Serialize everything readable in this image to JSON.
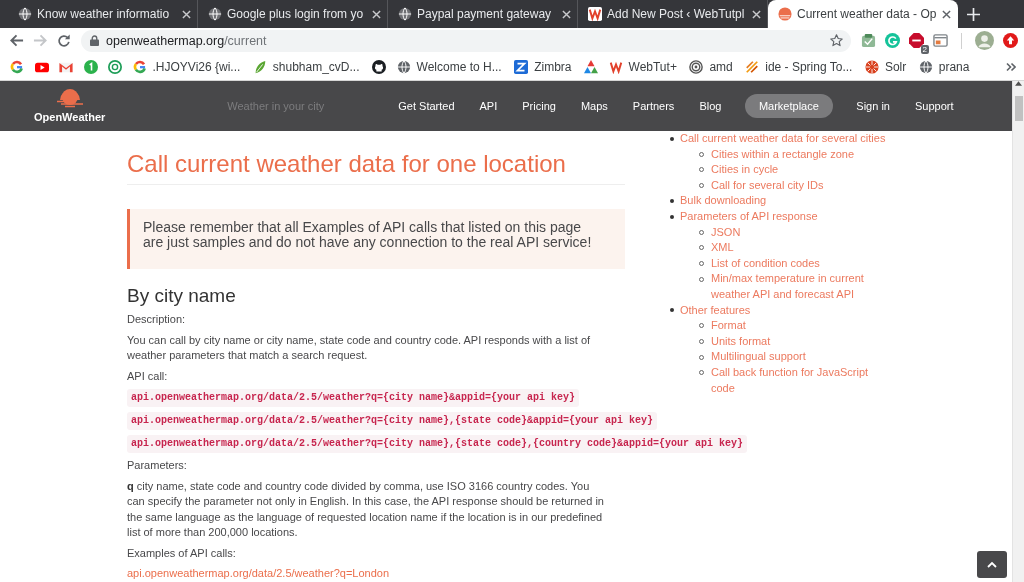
{
  "browser": {
    "tabs": [
      {
        "title": "Know weather informatio",
        "selected": false
      },
      {
        "title": "Google plus login from yo",
        "selected": false
      },
      {
        "title": "Paypal payment gateway",
        "selected": false
      },
      {
        "title": "Add New Post ‹ WebTutpl",
        "selected": false
      },
      {
        "title": "Current weather data - Op",
        "selected": true
      }
    ],
    "toolbar": {
      "forward_disabled": true,
      "url_host": "openweathermap.org",
      "url_path": "/current",
      "extension_badge": "2"
    },
    "bookmarks": [
      {
        "kind": "icon"
      },
      {
        "kind": "icon"
      },
      {
        "kind": "icon"
      },
      {
        "kind": "icon"
      },
      {
        "kind": "icon"
      },
      {
        "kind": "link",
        "label": ".HJOYVi26 {wi..."
      },
      {
        "kind": "link",
        "label": "shubham_cvD..."
      },
      {
        "kind": "icon"
      },
      {
        "kind": "link",
        "label": "Welcome to H..."
      },
      {
        "kind": "link",
        "label": "Zimbra"
      },
      {
        "kind": "icon"
      },
      {
        "kind": "link",
        "label": "WebTut+"
      },
      {
        "kind": "link",
        "label": "amd"
      },
      {
        "kind": "link",
        "label": "ide - Spring To..."
      },
      {
        "kind": "link",
        "label": "Solr"
      },
      {
        "kind": "link",
        "label": "prana"
      }
    ]
  },
  "site_header": {
    "logo_text": "OpenWeather",
    "search": {
      "placeholder": "Weather in your city"
    },
    "nav": [
      {
        "label": "Get Started",
        "kind": "link"
      },
      {
        "label": "API",
        "kind": "link"
      },
      {
        "label": "Pricing",
        "kind": "link"
      },
      {
        "label": "Maps",
        "kind": "link"
      },
      {
        "label": "Partners",
        "kind": "link"
      },
      {
        "label": "Blog",
        "kind": "link"
      },
      {
        "label": "Marketplace",
        "kind": "pill"
      },
      {
        "label": "Sign in",
        "kind": "link"
      },
      {
        "label": "Support",
        "kind": "link"
      }
    ]
  },
  "article": {
    "title": "Call current weather data for one location",
    "notice": "Please remember that all Examples of API calls that listed on this page are just samples and do not have any connection to the real API service!",
    "heading": "By city name",
    "blocks": [
      {
        "kind": "text",
        "text": "Description:"
      },
      {
        "kind": "text",
        "text": "You can call by city name or city name, state code and country code. API responds with a list of weather parameters that match a search request."
      },
      {
        "kind": "text",
        "text": "API call:"
      },
      {
        "kind": "code",
        "text": "api.openweathermap.org/data/2.5/weather?q={city name}&appid={your api key}"
      },
      {
        "kind": "code",
        "text": "api.openweathermap.org/data/2.5/weather?q={city name},{state code}&appid={your api key}"
      },
      {
        "kind": "code",
        "text": "api.openweathermap.org/data/2.5/weather?q={city name},{state code},{country code}&appid={your api key}"
      },
      {
        "kind": "text",
        "text": "Parameters:"
      },
      {
        "kind": "text",
        "text": "**q** city name, state code and country code divided by comma, use ISO 3166 country codes. You can specify the parameter not only in English. In this case, the API response should be returned in the same language as the language of requested location name if the location is in our predefined list of more than 200,000 locations."
      },
      {
        "kind": "text",
        "text": "Examples of API calls:"
      },
      {
        "kind": "link",
        "text": "api.openweathermap.org/data/2.5/weather?q=London"
      }
    ]
  },
  "sidebar": {
    "items": [
      {
        "label": "Call current weather data for several cities",
        "children": [
          {
            "label": "Cities within a rectangle zone"
          },
          {
            "label": "Cities in cycle"
          },
          {
            "label": "Call for several city IDs"
          }
        ]
      },
      {
        "label": "Bulk downloading"
      },
      {
        "label": "Parameters of API response",
        "children": [
          {
            "label": "JSON"
          },
          {
            "label": "XML"
          },
          {
            "label": "List of condition codes"
          },
          {
            "label": "Min/max temperature in current weather API and forecast API"
          }
        ]
      },
      {
        "label": "Other features",
        "children": [
          {
            "label": "Format"
          },
          {
            "label": "Units format"
          },
          {
            "label": "Multilingual support"
          },
          {
            "label": "Call back function for JavaScript code"
          }
        ]
      }
    ]
  }
}
